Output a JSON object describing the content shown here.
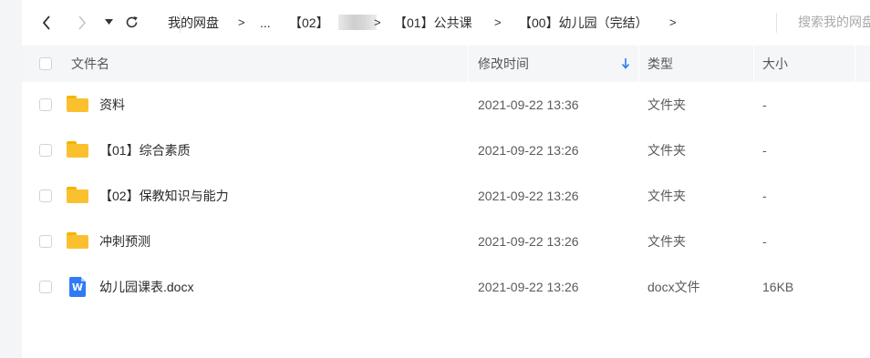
{
  "toolbar": {
    "breadcrumb": [
      "我的网盘",
      "...",
      "【02】",
      "【01】公共课",
      "【00】幼儿园（完结）"
    ],
    "search_placeholder": "搜索我的网盘文"
  },
  "table": {
    "headers": {
      "name": "文件名",
      "modified": "修改时间",
      "type": "类型",
      "size": "大小"
    },
    "sort": {
      "column": "modified",
      "direction": "desc"
    },
    "rows": [
      {
        "icon": "folder-icon",
        "name": "资料",
        "modified": "2021-09-22 13:36",
        "type": "文件夹",
        "size": "-"
      },
      {
        "icon": "folder-icon",
        "name": "【01】综合素质",
        "modified": "2021-09-22 13:26",
        "type": "文件夹",
        "size": "-"
      },
      {
        "icon": "folder-icon",
        "name": "【02】保教知识与能力",
        "modified": "2021-09-22 13:26",
        "type": "文件夹",
        "size": "-"
      },
      {
        "icon": "folder-icon",
        "name": "冲刺预测",
        "modified": "2021-09-22 13:26",
        "type": "文件夹",
        "size": "-"
      },
      {
        "icon": "word-doc-icon",
        "icon_letter": "W",
        "name": "幼儿园课表.docx",
        "modified": "2021-09-22 13:26",
        "type": "docx文件",
        "size": "16KB"
      }
    ]
  },
  "colors": {
    "folder": "#fbc02d",
    "word": "#2f7bf5",
    "sort_arrow": "#2f7bf5"
  }
}
